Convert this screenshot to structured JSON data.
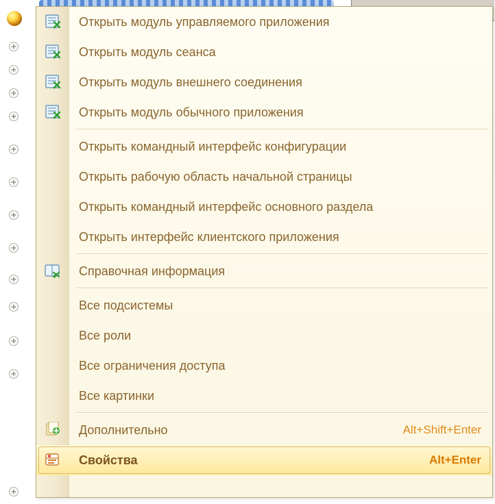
{
  "menu": {
    "items": [
      {
        "icon": "module",
        "label": "Открыть модуль управляемого приложения"
      },
      {
        "icon": "module",
        "label": "Открыть модуль сеанса"
      },
      {
        "icon": "module",
        "label": "Открыть модуль внешнего соединения"
      },
      {
        "icon": "module",
        "label": "Открыть модуль обычного приложения"
      },
      {
        "sep": true
      },
      {
        "label": "Открыть командный интерфейс конфигурации"
      },
      {
        "label": "Открыть рабочую область начальной страницы"
      },
      {
        "label": "Открыть командный интерфейс основного раздела"
      },
      {
        "label": "Открыть интерфейс клиентского приложения"
      },
      {
        "sep": true
      },
      {
        "icon": "help",
        "label": "Справочная информация"
      },
      {
        "sep": true
      },
      {
        "label": "Все подсистемы"
      },
      {
        "label": "Все роли"
      },
      {
        "label": "Все ограничения доступа"
      },
      {
        "label": "Все картинки"
      },
      {
        "sep": true
      },
      {
        "icon": "extra",
        "label": "Дополнительно",
        "shortcut": "Alt+Shift+Enter"
      },
      {
        "icon": "props",
        "label": "Свойства",
        "shortcut": "Alt+Enter",
        "hover": true
      }
    ]
  },
  "tree": {
    "expander_rows": [
      60,
      94,
      128,
      162,
      210,
      258,
      306,
      354,
      400,
      440,
      490,
      538,
      710
    ]
  }
}
